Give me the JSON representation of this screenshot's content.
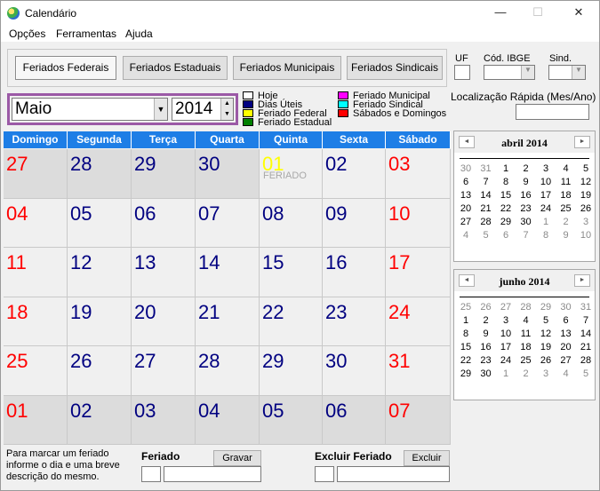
{
  "window": {
    "title": "Calendário",
    "minimize": "—",
    "maximize": "☐",
    "close": "✕"
  },
  "menu": [
    "Opções",
    "Ferramentas",
    "Ajuda"
  ],
  "tabs": [
    "Feriados Federais",
    "Feriados Estaduais",
    "Feriados Municipais",
    "Feriados Sindicais"
  ],
  "filters": {
    "uf_label": "UF",
    "ibge_label": "Cód. IBGE",
    "sind_label": "Sind."
  },
  "selector": {
    "month": "Maio",
    "year": "2014"
  },
  "legend": {
    "items": [
      {
        "label": "Hoje",
        "color": "#ffffff"
      },
      {
        "label": "Dias Úteis",
        "color": "#000080"
      },
      {
        "label": "Feriado Federal",
        "color": "#ffff00"
      },
      {
        "label": "Feriado Estadual",
        "color": "#008000"
      },
      {
        "label": "Feriado Municipal",
        "color": "#ff00ff"
      },
      {
        "label": "Feriado Sindical",
        "color": "#00ffff"
      },
      {
        "label": "Sábados e Domingos",
        "color": "#ff0000"
      }
    ]
  },
  "quick_location": {
    "label": "Localização Rápida (Mes/Ano)"
  },
  "calendar": {
    "headers": [
      "Domingo",
      "Segunda",
      "Terça",
      "Quarta",
      "Quinta",
      "Sexta",
      "Sábado"
    ],
    "colors": {
      "weekend": "#ff0000",
      "weekday": "#000080",
      "holiday": "#ffff00"
    },
    "holiday_note": "FERIADO",
    "weeks": [
      [
        "27",
        "28",
        "29",
        "30",
        "01",
        "02",
        "03"
      ],
      [
        "04",
        "05",
        "06",
        "07",
        "08",
        "09",
        "10"
      ],
      [
        "11",
        "12",
        "13",
        "14",
        "15",
        "16",
        "17"
      ],
      [
        "18",
        "19",
        "20",
        "21",
        "22",
        "23",
        "24"
      ],
      [
        "25",
        "26",
        "27",
        "28",
        "29",
        "30",
        "31"
      ],
      [
        "01",
        "02",
        "03",
        "04",
        "05",
        "06",
        "07"
      ]
    ]
  },
  "mini_april": {
    "title": "abril 2014",
    "prev": "◄",
    "next": "►",
    "weeks": [
      [
        "30",
        "31",
        "1",
        "2",
        "3",
        "4",
        "5"
      ],
      [
        "6",
        "7",
        "8",
        "9",
        "10",
        "11",
        "12"
      ],
      [
        "13",
        "14",
        "15",
        "16",
        "17",
        "18",
        "19"
      ],
      [
        "20",
        "21",
        "22",
        "23",
        "24",
        "25",
        "26"
      ],
      [
        "27",
        "28",
        "29",
        "30",
        "1",
        "2",
        "3"
      ],
      [
        "4",
        "5",
        "6",
        "7",
        "8",
        "9",
        "10"
      ]
    ]
  },
  "mini_june": {
    "title": "junho 2014",
    "prev": "◄",
    "next": "►",
    "weeks": [
      [
        "25",
        "26",
        "27",
        "28",
        "29",
        "30",
        "31"
      ],
      [
        "1",
        "2",
        "3",
        "4",
        "5",
        "6",
        "7"
      ],
      [
        "8",
        "9",
        "10",
        "11",
        "12",
        "13",
        "14"
      ],
      [
        "15",
        "16",
        "17",
        "18",
        "19",
        "20",
        "21"
      ],
      [
        "22",
        "23",
        "24",
        "25",
        "26",
        "27",
        "28"
      ],
      [
        "29",
        "30",
        "1",
        "2",
        "3",
        "4",
        "5"
      ]
    ]
  },
  "footer": {
    "hint": "Para marcar um feriado informe o dia e uma breve descrição do mesmo.",
    "holiday_label": "Feriado",
    "save_button": "Gravar",
    "delete_label": "Excluir Feriado",
    "delete_button": "Excluir"
  }
}
